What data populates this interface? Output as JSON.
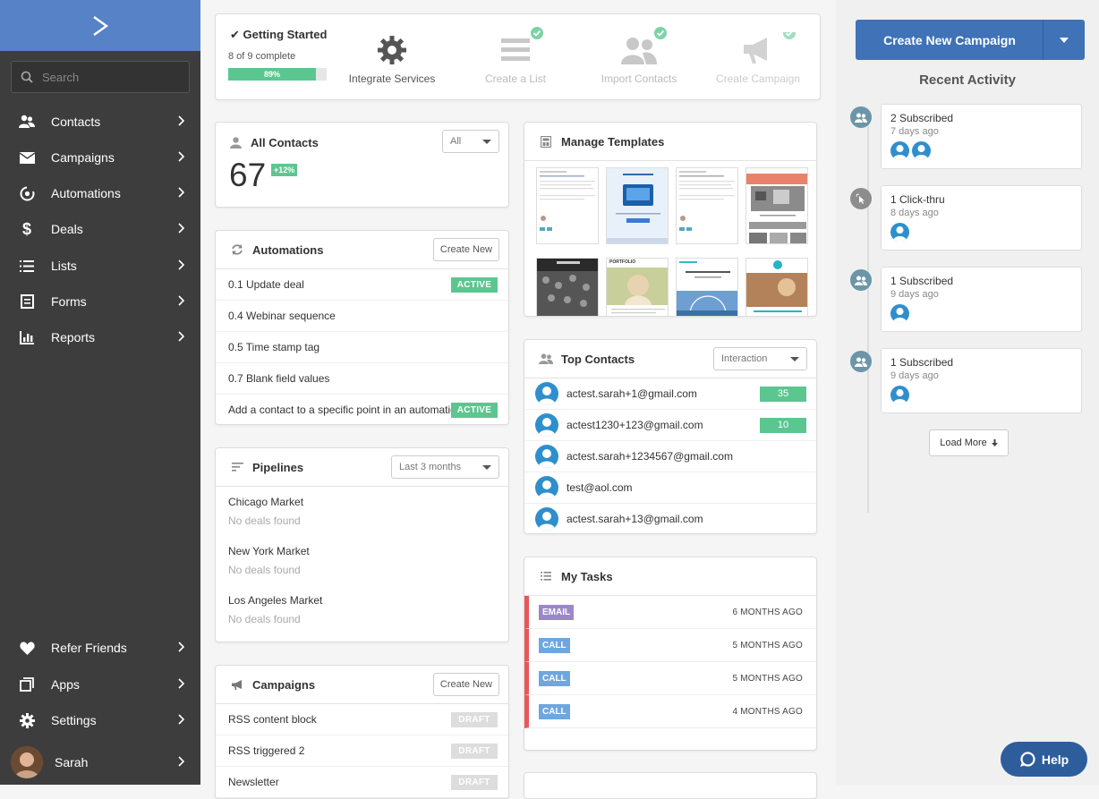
{
  "sidebar": {
    "search_placeholder": "Search",
    "items": [
      {
        "label": "Contacts",
        "icon": "contacts-icon"
      },
      {
        "label": "Campaigns",
        "icon": "envelope-icon"
      },
      {
        "label": "Automations",
        "icon": "automations-icon"
      },
      {
        "label": "Deals",
        "icon": "dollar-icon"
      },
      {
        "label": "Lists",
        "icon": "list-icon"
      },
      {
        "label": "Forms",
        "icon": "form-icon"
      },
      {
        "label": "Reports",
        "icon": "bar-chart-icon"
      }
    ],
    "bottom_items": [
      {
        "label": "Refer Friends",
        "icon": "heart-icon"
      },
      {
        "label": "Apps",
        "icon": "apps-icon"
      },
      {
        "label": "Settings",
        "icon": "gear-icon"
      }
    ],
    "user": {
      "name": "Sarah"
    }
  },
  "getting_started": {
    "title": "Getting Started",
    "progress_text": "8 of 9 complete",
    "progress_label": "89%",
    "progress_value": 0.89,
    "steps": [
      {
        "label": "Integrate Services",
        "done": false,
        "icon": "gear-icon"
      },
      {
        "label": "Create a List",
        "done": true,
        "icon": "list-icon"
      },
      {
        "label": "Import Contacts",
        "done": true,
        "icon": "contacts-icon"
      },
      {
        "label": "Create Campaign",
        "done": true,
        "icon": "megaphone-icon"
      }
    ]
  },
  "all_contacts": {
    "title": "All Contacts",
    "filter": "All",
    "count": "67",
    "change": "+12%"
  },
  "automations": {
    "title": "Automations",
    "create_label": "Create New",
    "rows": [
      {
        "name": "0.1 Update deal",
        "status": "ACTIVE"
      },
      {
        "name": "0.4 Webinar sequence",
        "status": ""
      },
      {
        "name": "0.5 Time stamp tag",
        "status": ""
      },
      {
        "name": "0.7 Blank field values",
        "status": ""
      },
      {
        "name": "Add a contact to a specific point in an automation",
        "status": "ACTIVE"
      }
    ]
  },
  "pipelines": {
    "title": "Pipelines",
    "filter": "Last 3 months",
    "rows": [
      {
        "name": "Chicago Market",
        "empty": "No deals found"
      },
      {
        "name": "New York Market",
        "empty": "No deals found"
      },
      {
        "name": "Los Angeles Market",
        "empty": "No deals found"
      }
    ]
  },
  "campaigns": {
    "title": "Campaigns",
    "create_label": "Create New",
    "rows": [
      {
        "name": "RSS content block",
        "status": "DRAFT"
      },
      {
        "name": "RSS triggered 2",
        "status": "DRAFT"
      },
      {
        "name": "Newsletter",
        "status": "DRAFT"
      }
    ]
  },
  "templates": {
    "title": "Manage Templates",
    "template_texts": [
      "PORTFOLIO"
    ]
  },
  "top_contacts": {
    "title": "Top Contacts",
    "filter": "Interaction",
    "rows": [
      {
        "email": "actest.sarah+1@gmail.com",
        "score": "35"
      },
      {
        "email": "actest1230+123@gmail.com",
        "score": "10"
      },
      {
        "email": "actest.sarah+1234567@gmail.com",
        "score": ""
      },
      {
        "email": "test@aol.com",
        "score": ""
      },
      {
        "email": "actest.sarah+13@gmail.com",
        "score": ""
      }
    ]
  },
  "tasks": {
    "title": "My Tasks",
    "rows": [
      {
        "type": "EMAIL",
        "when": "6 MONTHS AGO",
        "color": "#9a88c9"
      },
      {
        "type": "CALL",
        "when": "5 MONTHS AGO",
        "color": "#6fa6e0"
      },
      {
        "type": "CALL",
        "when": "5 MONTHS AGO",
        "color": "#6fa6e0"
      },
      {
        "type": "CALL",
        "when": "4 MONTHS AGO",
        "color": "#6fa6e0"
      }
    ]
  },
  "right_panel": {
    "create_label": "Create New Campaign",
    "activity_title": "Recent Activity",
    "activities": [
      {
        "title": "2 Subscribed",
        "when": "7 days ago",
        "avatars": 2,
        "icon": "subscribed-icon"
      },
      {
        "title": "1 Click-thru",
        "when": "8 days ago",
        "avatars": 1,
        "icon": "click-icon"
      },
      {
        "title": "1 Subscribed",
        "when": "9 days ago",
        "avatars": 1,
        "icon": "subscribed-icon"
      },
      {
        "title": "1 Subscribed",
        "when": "9 days ago",
        "avatars": 1,
        "icon": "subscribed-icon"
      }
    ],
    "load_more": "Load More"
  },
  "help_label": "Help",
  "colors": {
    "brand": "#5882c7",
    "sidebar": "#3d3d3d",
    "primary_button": "#3f72b6",
    "success": "#5cc690",
    "task_border": "#e9565a"
  }
}
